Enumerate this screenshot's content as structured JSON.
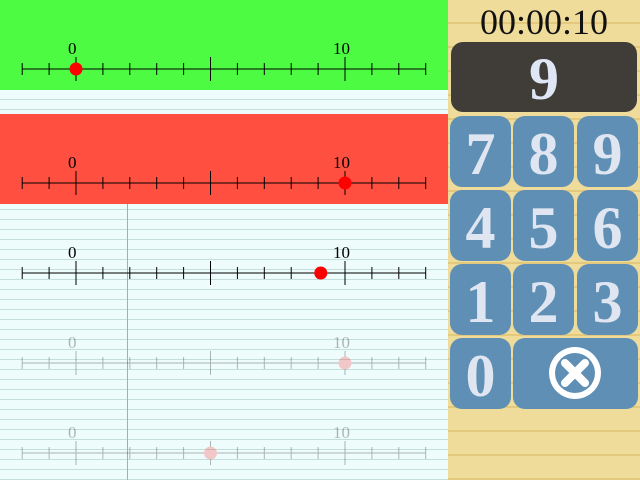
{
  "timer": "00:00:10",
  "answer_display": "9",
  "number_lines": [
    {
      "band_color": "#4cfb42",
      "label_start": "0",
      "label_end": "10",
      "marker_value": 0,
      "marker_color": "#ff0000",
      "faded": false
    },
    {
      "band_color": "#ff4f40",
      "label_start": "0",
      "label_end": "10",
      "marker_value": 10,
      "marker_color": "#ff0000",
      "faded": false
    },
    {
      "band_color": "",
      "label_start": "0",
      "label_end": "10",
      "marker_value": 9.1,
      "marker_color": "#ff0000",
      "faded": false
    },
    {
      "band_color": "",
      "label_start": "0",
      "label_end": "10",
      "marker_value": 10,
      "marker_color": "#ff4040",
      "faded": true
    },
    {
      "band_color": "",
      "label_start": "0",
      "label_end": "10",
      "marker_value": 5,
      "marker_color": "#ff4040",
      "faded": true
    }
  ],
  "keypad": {
    "keys": [
      "7",
      "8",
      "9",
      "4",
      "5",
      "6",
      "1",
      "2",
      "3",
      "0"
    ],
    "clear_icon": "close-circle-icon"
  },
  "colors": {
    "notebook_bg": "#eefcfc",
    "panel_bg": "#f0dc9a",
    "display_bg": "#403c38",
    "key_bg": "#5f8fb4",
    "key_text": "#dfe6f2"
  }
}
